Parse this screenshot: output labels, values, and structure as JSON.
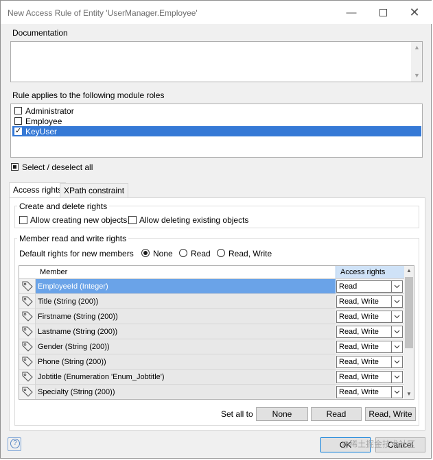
{
  "window": {
    "title": "New Access Rule of Entity 'UserManager.Employee'"
  },
  "documentation": {
    "label": "Documentation",
    "value": ""
  },
  "roles": {
    "label": "Rule applies to the following module roles",
    "items": [
      {
        "name": "Administrator",
        "checked": false,
        "selected": false
      },
      {
        "name": "Employee",
        "checked": false,
        "selected": false
      },
      {
        "name": "KeyUser",
        "checked": true,
        "selected": true
      }
    ],
    "select_all_label": "Select / deselect all"
  },
  "tabs": [
    {
      "label": "Access rights",
      "active": true
    },
    {
      "label": "XPath constraint",
      "active": false
    }
  ],
  "create_delete": {
    "label": "Create and delete rights",
    "allow_create_label": "Allow creating new objects",
    "allow_delete_label": "Allow deleting existing objects"
  },
  "member_rights": {
    "label": "Member read and write rights",
    "default_label": "Default rights for new members",
    "options": [
      "None",
      "Read",
      "Read, Write"
    ],
    "selected": "None",
    "columns": {
      "member": "Member",
      "access": "Access rights"
    },
    "rows": [
      {
        "member": "EmployeeId (Integer)",
        "access": "Read",
        "selected": true
      },
      {
        "member": "Title (String (200))",
        "access": "Read, Write",
        "selected": false
      },
      {
        "member": "Firstname (String (200))",
        "access": "Read, Write",
        "selected": false
      },
      {
        "member": "Lastname (String (200))",
        "access": "Read, Write",
        "selected": false
      },
      {
        "member": "Gender (String (200))",
        "access": "Read, Write",
        "selected": false
      },
      {
        "member": "Phone (String (200))",
        "access": "Read, Write",
        "selected": false
      },
      {
        "member": "Jobtitle (Enumeration 'Enum_Jobtitle')",
        "access": "Read, Write",
        "selected": false
      },
      {
        "member": "Specialty (String (200))",
        "access": "Read, Write",
        "selected": false
      }
    ],
    "set_all_label": "Set all to",
    "set_all_buttons": [
      "None",
      "Read",
      "Read, Write"
    ]
  },
  "footer": {
    "help_icon": "question-icon",
    "ok_label": "OK",
    "cancel_label": "Cancel",
    "watermark": "@稀土掘金技术社区"
  }
}
